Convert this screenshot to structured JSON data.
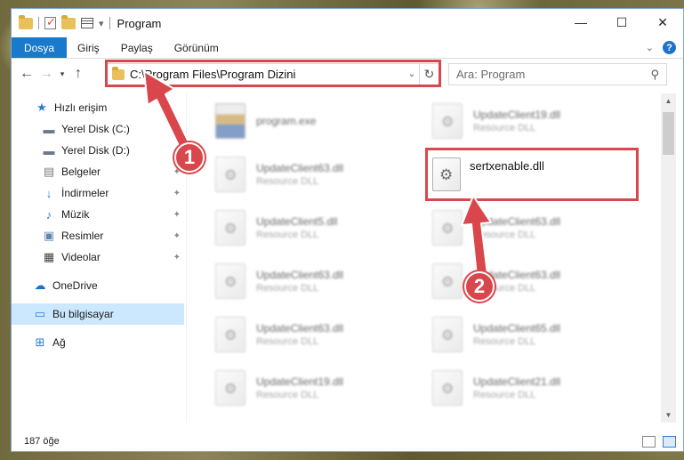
{
  "window": {
    "title": "Program",
    "controls": {
      "minimize": "—",
      "maximize": "☐",
      "close": "✕"
    }
  },
  "ribbon": {
    "tabs": [
      "Dosya",
      "Giriş",
      "Paylaş",
      "Görünüm"
    ]
  },
  "navigation": {
    "address": "C:\\Program Files\\Program Dizini",
    "search_placeholder": "Ara: Program"
  },
  "sidebar": {
    "items": [
      {
        "label": "Hızlı erişim",
        "icon": "star-icon"
      },
      {
        "label": "Yerel Disk (C:)",
        "icon": "drive-icon"
      },
      {
        "label": "Yerel Disk (D:)",
        "icon": "drive-icon"
      },
      {
        "label": "Belgeler",
        "icon": "documents-icon"
      },
      {
        "label": "İndirmeler",
        "icon": "download-icon"
      },
      {
        "label": "Müzik",
        "icon": "music-icon"
      },
      {
        "label": "Resimler",
        "icon": "pictures-icon"
      },
      {
        "label": "Videolar",
        "icon": "video-icon"
      },
      {
        "label": "OneDrive",
        "icon": "cloud-icon"
      },
      {
        "label": "Bu bilgisayar",
        "icon": "computer-icon"
      },
      {
        "label": "Ağ",
        "icon": "network-icon"
      }
    ]
  },
  "files": [
    {
      "name": "program.exe",
      "desc": ""
    },
    {
      "name": "UpdateClient19.dll",
      "desc": "Resource DLL"
    },
    {
      "name": "UpdateClient63.dll",
      "desc": "Resource DLL"
    },
    {
      "name": "UpdateClient5.dll",
      "desc": "Resource DLL"
    },
    {
      "name": "UpdateClient63.dll",
      "desc": "Resource DLL"
    },
    {
      "name": "UpdateClient63.dll",
      "desc": "Resource DLL"
    },
    {
      "name": "UpdateClient63.dll",
      "desc": "Resource DLL"
    },
    {
      "name": "UpdateClient63.dll",
      "desc": "Resource DLL"
    },
    {
      "name": "UpdateClient65.dll",
      "desc": "Resource DLL"
    },
    {
      "name": "UpdateClient19.dll",
      "desc": "Resource DLL"
    },
    {
      "name": "UpdateClient21.dll",
      "desc": "Resource DLL"
    }
  ],
  "highlighted_file": {
    "name": "sertxenable.dll"
  },
  "status": {
    "item_count": "187 öğe"
  },
  "annotations": {
    "step1": "1",
    "step2": "2",
    "color": "#d9464b"
  }
}
